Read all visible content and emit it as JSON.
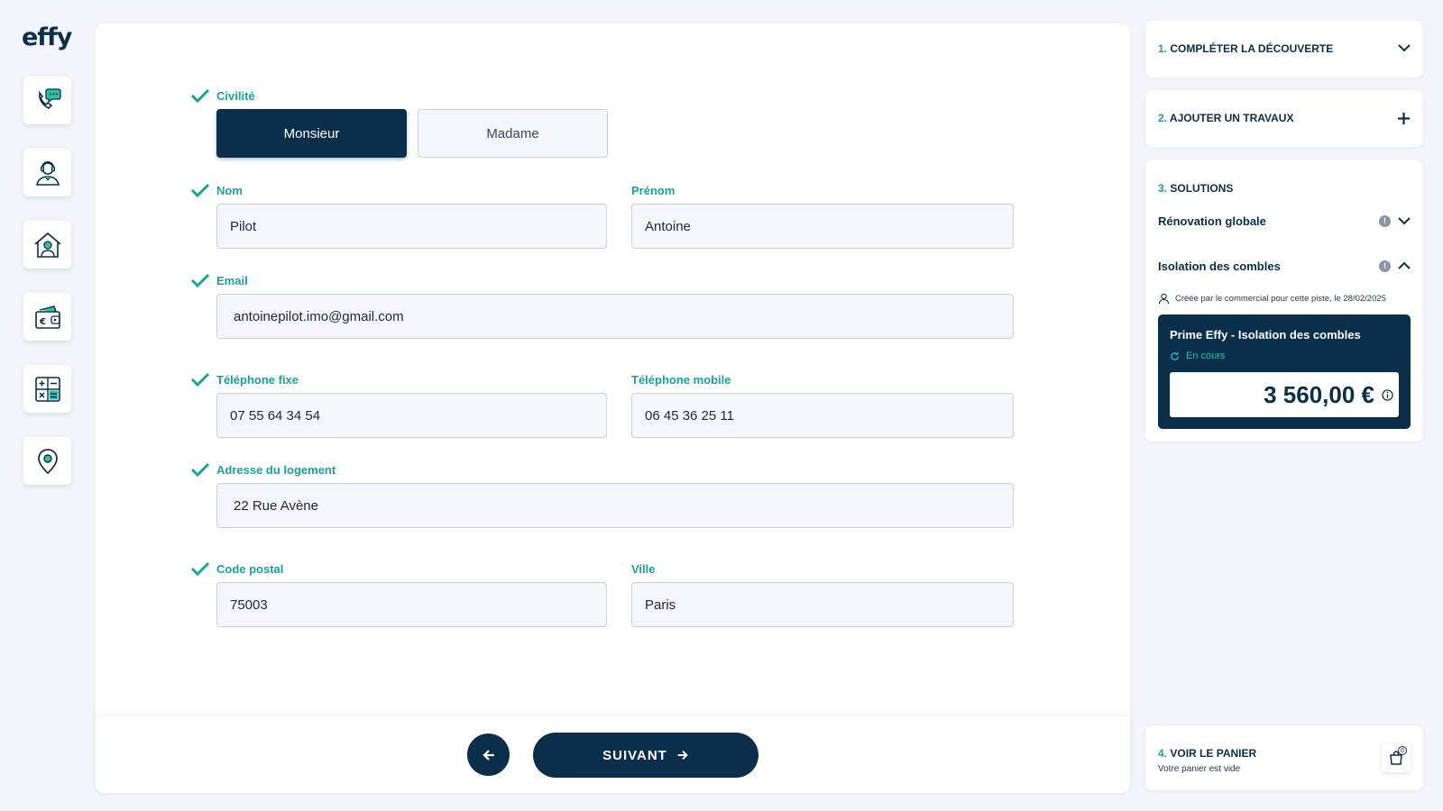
{
  "app": {
    "logo": "effy"
  },
  "sidebar": {
    "items": [
      {
        "name": "phone-chat",
        "icon": "phone-chat-icon"
      },
      {
        "name": "advisor",
        "icon": "advisor-icon"
      },
      {
        "name": "home-person",
        "icon": "home-person-icon"
      },
      {
        "name": "wallet",
        "icon": "wallet-euro-icon"
      },
      {
        "name": "calculator",
        "icon": "calculator-icon"
      },
      {
        "name": "location",
        "icon": "location-pin-icon"
      }
    ]
  },
  "form": {
    "civility": {
      "label": "Civilité",
      "options": [
        "Monsieur",
        "Madame"
      ],
      "selected": "Monsieur"
    },
    "nom": {
      "label": "Nom",
      "value": "Pilot"
    },
    "prenom": {
      "label": "Prénom",
      "value": "Antoine"
    },
    "email": {
      "label": "Email",
      "value": "antoinepilot.imo@gmail.com"
    },
    "tel_fixe": {
      "label": "Téléphone fixe",
      "value": "07 55 64 34 54"
    },
    "tel_mobile": {
      "label": "Téléphone mobile",
      "value": "06 45 36 25 11"
    },
    "adresse": {
      "label": "Adresse du logement",
      "value": "22 Rue Avène"
    },
    "code_postal": {
      "label": "Code postal",
      "value": "75003"
    },
    "ville": {
      "label": "Ville",
      "value": "Paris"
    }
  },
  "footer": {
    "next_label": "SUIVANT"
  },
  "steps": {
    "step1": {
      "num": "1.",
      "label": "COMPLÉTER LA DÉCOUVERTE"
    },
    "step2": {
      "num": "2.",
      "label": "AJOUTER UN TRAVAUX"
    },
    "step3": {
      "num": "3.",
      "label": "SOLUTIONS",
      "solutions": [
        {
          "label": "Rénovation globale",
          "badge": "!"
        },
        {
          "label": "Isolation des combles",
          "badge": "!"
        }
      ],
      "created_note": "Créée par le commercial pour cette piste, le 28/02/2025",
      "prime": {
        "title": "Prime Effy - Isolation des combles",
        "status": "En cours",
        "amount": "3 560,00 €"
      }
    },
    "step4": {
      "num": "4.",
      "label": "VOIR LE PANIER",
      "sub": "Votre panier est vide",
      "cart_count": "0"
    }
  },
  "colors": {
    "navy": "#0b2e4a",
    "teal": "#16a59a",
    "bg": "#f3f5fa"
  }
}
